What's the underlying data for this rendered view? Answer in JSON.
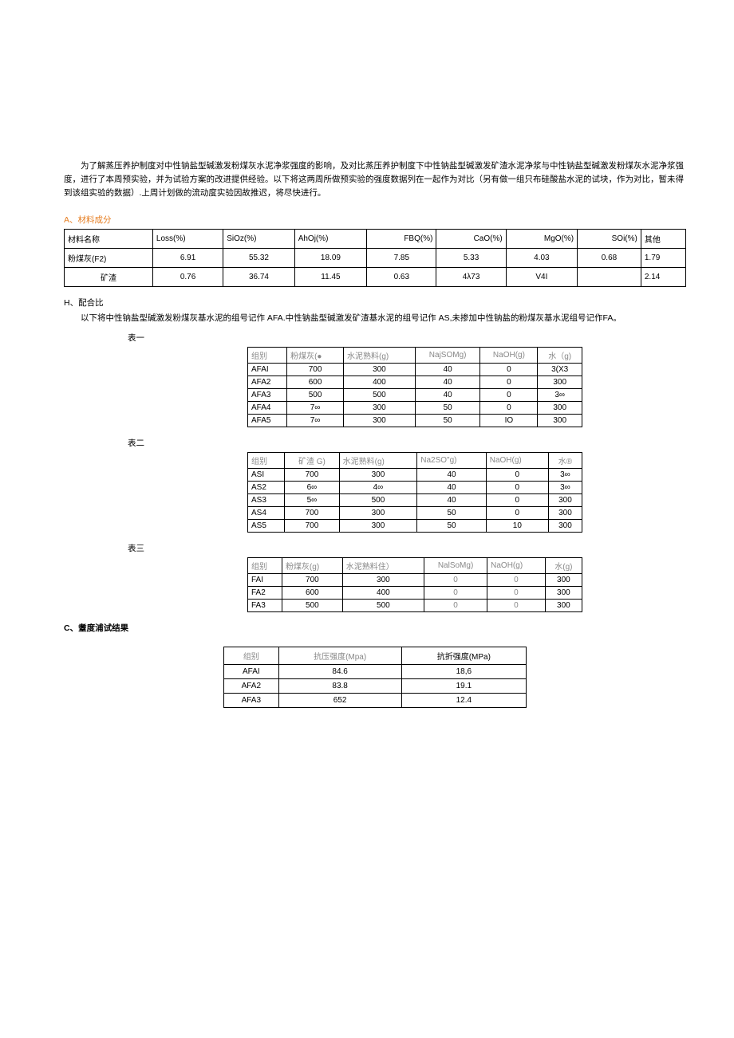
{
  "intro": "为了解蒸压养护制度对中性钠盐型碱激发粉煤灰水泥净浆强度的影响，及对比蒸压养护制度下中性钠盐型碱激发矿渣水泥净浆与中性钠盐型碱激发粉煤灰水泥净浆强度，进行了本周预实验，并为试验方案的改进提供经验。以下将这两周所做预实验的强度数据列在一起作为对比（另有做一组只布硅酸盐水泥的试块，作为对比，暂未得到该组实验的数据）.上周计划做的流动度实验因故推迟，将尽快进行。",
  "sectionA": "A、材料成分",
  "tableA": {
    "headers": [
      "材料名称",
      "Loss(%)",
      "SiOz(%)",
      "AhOj(%)",
      "FBQ(%)",
      "CaO(%)",
      "MgO(%)",
      "SOi(%)",
      "其他"
    ],
    "rows": [
      [
        "粉煤灰(F2)",
        "6.91",
        "55.32",
        "18.09",
        "7.85",
        "5.33",
        "4.03",
        "0.68",
        "1.79"
      ],
      [
        "矿渣",
        "0.76",
        "36.74",
        "11.45",
        "0.63",
        "4λ73",
        "V4I",
        "",
        "2.14"
      ]
    ]
  },
  "sectionH": "H、配合比",
  "configNote": "以下将中性钠盐型碱激发粉煤灰基水泥的组号记作 AFA.中性钠盐型碱激发矿渣基水泥的组号记作 AS,未掺加中性钠盐的粉煤灰基水泥组号记作FA。",
  "label1": "表一",
  "table1": {
    "headers": [
      "组别",
      "粉煤灰(●",
      "水泥熟料(g)",
      "NajSOMg)",
      "NaOH(g)",
      "水（g)"
    ],
    "rows": [
      [
        "AFAI",
        "700",
        "300",
        "40",
        "0",
        "3(X3"
      ],
      [
        "AFA2",
        "600",
        "400",
        "40",
        "0",
        "300"
      ],
      [
        "AFA3",
        "500",
        "500",
        "40",
        "0",
        "3∞"
      ],
      [
        "AFA4",
        "7∞",
        "300",
        "50",
        "0",
        "300"
      ],
      [
        "AFA5",
        "7∞",
        "300",
        "50",
        "IO",
        "300"
      ]
    ]
  },
  "label2": "表二",
  "table2": {
    "headers": [
      "组别",
      "矿渣 G)",
      "水泥熟料(g)",
      "Na2SO\"g)",
      "NaOH(g)",
      "水®"
    ],
    "rows": [
      [
        "ASI",
        "700",
        "300",
        "40",
        "0",
        "3∞"
      ],
      [
        "AS2",
        "6∞",
        "4∞",
        "40",
        "0",
        "3∞"
      ],
      [
        "AS3",
        "5∞",
        "500",
        "40",
        "0",
        "300"
      ],
      [
        "AS4",
        "700",
        "300",
        "50",
        "0",
        "300"
      ],
      [
        "AS5",
        "700",
        "300",
        "50",
        "10",
        "300"
      ]
    ]
  },
  "label3": "表三",
  "table3": {
    "headers": [
      "组别",
      "粉煤灰(g)",
      "水泥熟料住）",
      "NalSoMg)",
      "NaOH(g)",
      "水(g)"
    ],
    "rows": [
      [
        "FAI",
        "700",
        "300",
        "0",
        "0",
        "300"
      ],
      [
        "FA2",
        "600",
        "400",
        "0",
        "0",
        "300"
      ],
      [
        "FA3",
        "500",
        "500",
        "0",
        "0",
        "300"
      ]
    ]
  },
  "sectionC": "C、耋度浦试结果",
  "tableC": {
    "headers": [
      "组别",
      "抗压强度(Mpa)",
      "抗折强度(MPa)"
    ],
    "rows": [
      [
        "AFAI",
        "84.6",
        "18,6"
      ],
      [
        "AFA2",
        "83.8",
        "19.1"
      ],
      [
        "AFA3",
        "652",
        "12.4"
      ]
    ]
  }
}
